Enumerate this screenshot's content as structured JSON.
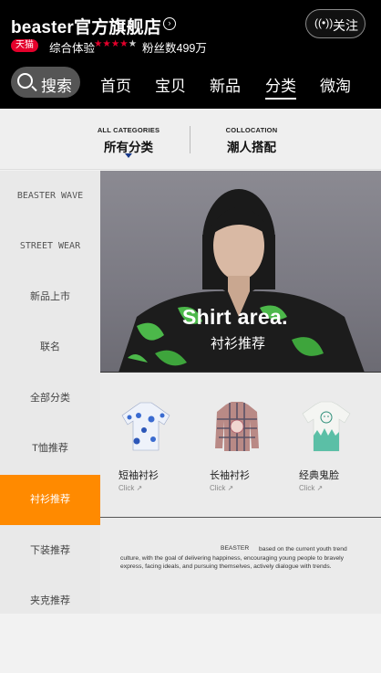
{
  "store": {
    "name": "beaster官方旗舰店",
    "chevron_icon": "chevron-right-icon",
    "follow_icon": "radio-wave-icon",
    "follow_label": "关注",
    "badge": "天猫",
    "rating_label": "综合体验",
    "rating_stars": 4,
    "rating_stars_total": 5,
    "fans": "粉丝数499万"
  },
  "nav": {
    "search_label": "搜索",
    "items": [
      "首页",
      "宝贝",
      "新品",
      "分类",
      "微淘"
    ],
    "active": "分类"
  },
  "category_tabs": [
    {
      "en": "ALL CATEGORIES",
      "cn": "所有分类"
    },
    {
      "en": "COLLOCATION",
      "cn": "潮人搭配"
    }
  ],
  "sidebar": {
    "items": [
      "BEASTER WAVE",
      "STREET WEAR",
      "新品上市",
      "联名",
      "全部分类",
      "T恤推荐",
      "衬衫推荐",
      "下装推荐",
      "夹克推荐"
    ],
    "active": "衬衫推荐"
  },
  "hero": {
    "title": "Shirt area.",
    "subtitle": "衬衫推荐"
  },
  "products": [
    {
      "name": "短袖衬衫",
      "click": "Click ↗"
    },
    {
      "name": "长袖衬衫",
      "click": "Click ↗"
    },
    {
      "name": "经典鬼脸",
      "click": "Click ↗"
    }
  ],
  "about": {
    "brand": "BEASTER",
    "text": "based on the current youth trend culture, with the goal of delivering happiness, encouraging young people to bravely express, facing ideals, and pursuing themselves, actively dialogue with trends."
  },
  "colors": {
    "header_bg": "#000000",
    "accent_orange": "#ff8a00",
    "tmall_red": "#e4002b"
  }
}
